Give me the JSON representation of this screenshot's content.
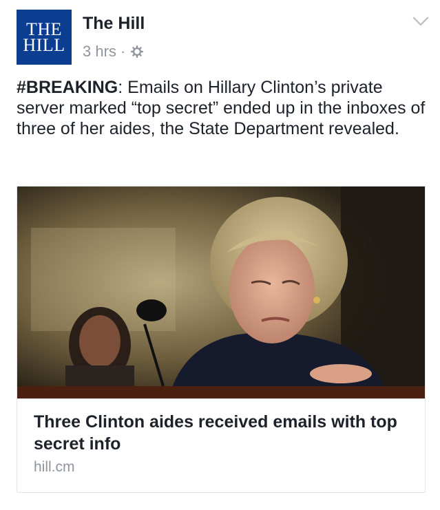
{
  "post": {
    "page_name": "The Hill",
    "logo": {
      "line1": "THE",
      "line2": "HILL"
    },
    "time": "3 hrs",
    "separator": "·",
    "icons": {
      "privacy": "gear-icon",
      "menu": "chevron-down-icon"
    },
    "message_bold": "#BREAKING",
    "message_rest": ": Emails on Hillary Clinton’s private server marked “top secret” ended up in the inboxes of three of her aides, the State Department revealed."
  },
  "link_card": {
    "title": "Three Clinton aides received emails with top secret info",
    "domain": "hill.cm"
  },
  "colors": {
    "logo_bg": "#0b3d91",
    "meta_text": "#90949c",
    "text": "#1d2129"
  }
}
